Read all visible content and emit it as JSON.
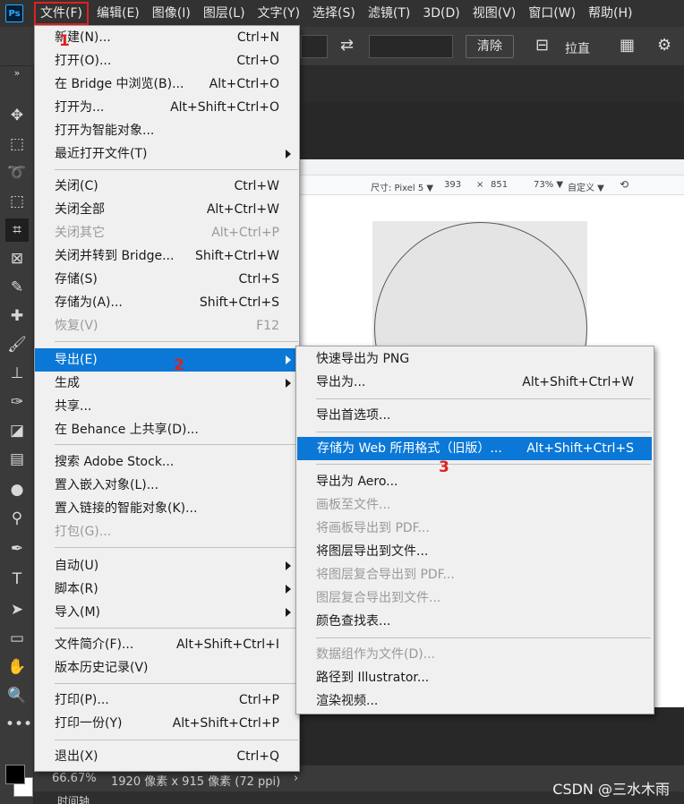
{
  "app": {
    "logo": "Ps"
  },
  "menubar": {
    "items": [
      "文件(F)",
      "编辑(E)",
      "图像(I)",
      "图层(L)",
      "文字(Y)",
      "选择(S)",
      "滤镜(T)",
      "3D(D)",
      "视图(V)",
      "窗口(W)",
      "帮助(H)"
    ]
  },
  "options_bar": {
    "clear_label": "清除",
    "straighten_label": "拉直"
  },
  "file_menu": {
    "items": [
      {
        "label": "新建(N)...",
        "shortcut": "Ctrl+N"
      },
      {
        "label": "打开(O)...",
        "shortcut": "Ctrl+O"
      },
      {
        "label": "在 Bridge 中浏览(B)...",
        "shortcut": "Alt+Ctrl+O"
      },
      {
        "label": "打开为...",
        "shortcut": "Alt+Shift+Ctrl+O"
      },
      {
        "label": "打开为智能对象...",
        "shortcut": ""
      },
      {
        "label": "最近打开文件(T)",
        "shortcut": ""
      },
      {
        "label": "关闭(C)",
        "shortcut": "Ctrl+W"
      },
      {
        "label": "关闭全部",
        "shortcut": "Alt+Ctrl+W"
      },
      {
        "label": "关闭其它",
        "shortcut": "Alt+Ctrl+P"
      },
      {
        "label": "关闭并转到 Bridge...",
        "shortcut": "Shift+Ctrl+W"
      },
      {
        "label": "存储(S)",
        "shortcut": "Ctrl+S"
      },
      {
        "label": "存储为(A)...",
        "shortcut": "Shift+Ctrl+S"
      },
      {
        "label": "恢复(V)",
        "shortcut": "F12"
      },
      {
        "label": "导出(E)",
        "shortcut": ""
      },
      {
        "label": "生成",
        "shortcut": ""
      },
      {
        "label": "共享...",
        "shortcut": ""
      },
      {
        "label": "在 Behance 上共享(D)...",
        "shortcut": ""
      },
      {
        "label": "搜索 Adobe Stock...",
        "shortcut": ""
      },
      {
        "label": "置入嵌入对象(L)...",
        "shortcut": ""
      },
      {
        "label": "置入链接的智能对象(K)...",
        "shortcut": ""
      },
      {
        "label": "打包(G)...",
        "shortcut": ""
      },
      {
        "label": "自动(U)",
        "shortcut": ""
      },
      {
        "label": "脚本(R)",
        "shortcut": ""
      },
      {
        "label": "导入(M)",
        "shortcut": ""
      },
      {
        "label": "文件简介(F)...",
        "shortcut": "Alt+Shift+Ctrl+I"
      },
      {
        "label": "版本历史记录(V)",
        "shortcut": ""
      },
      {
        "label": "打印(P)...",
        "shortcut": "Ctrl+P"
      },
      {
        "label": "打印一份(Y)",
        "shortcut": "Alt+Shift+Ctrl+P"
      },
      {
        "label": "退出(X)",
        "shortcut": "Ctrl+Q"
      }
    ]
  },
  "export_menu": {
    "items": [
      {
        "label": "快速导出为 PNG",
        "shortcut": ""
      },
      {
        "label": "导出为...",
        "shortcut": "Alt+Shift+Ctrl+W"
      },
      {
        "label": "导出首选项...",
        "shortcut": ""
      },
      {
        "label": "存储为 Web 所用格式（旧版）...",
        "shortcut": "Alt+Shift+Ctrl+S"
      },
      {
        "label": "导出为 Aero...",
        "shortcut": ""
      },
      {
        "label": "画板至文件...",
        "shortcut": ""
      },
      {
        "label": "将画板导出到 PDF...",
        "shortcut": ""
      },
      {
        "label": "将图层导出到文件...",
        "shortcut": ""
      },
      {
        "label": "将图层复合导出到 PDF...",
        "shortcut": ""
      },
      {
        "label": "图层复合导出到文件...",
        "shortcut": ""
      },
      {
        "label": "颜色查找表...",
        "shortcut": ""
      },
      {
        "label": "数据组作为文件(D)...",
        "shortcut": ""
      },
      {
        "label": "路径到 Illustrator...",
        "shortcut": ""
      },
      {
        "label": "渲染视频...",
        "shortcut": ""
      }
    ]
  },
  "annotations": [
    "1",
    "2",
    "3"
  ],
  "document": {
    "devtools": {
      "size_label": "尺寸: Pixel 5 ▼",
      "width": "393",
      "times": "×",
      "height": "851",
      "zoom": "73% ▼",
      "custom": "自定义 ▼"
    }
  },
  "statusbar": {
    "zoom": "66.67%",
    "doc_info": "1920 像素 x 915 像素 (72 ppi)"
  },
  "timeline_tab": "时间轴",
  "watermark": "CSDN @三水木雨",
  "colors": {
    "menu_bg": "#f0f0f0",
    "highlight": "#0b78d7",
    "annotation": "#e02020"
  }
}
